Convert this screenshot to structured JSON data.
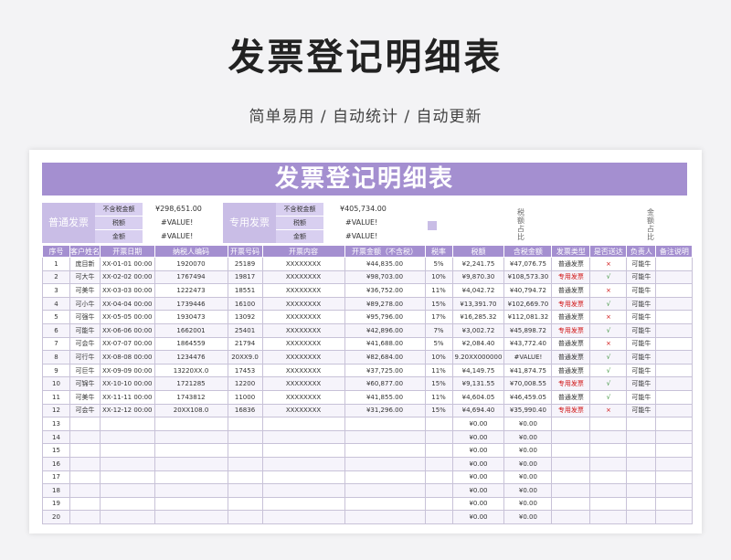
{
  "page": {
    "title": "发票登记明细表",
    "subtitle": "简单易用 / 自动统计 / 自动更新"
  },
  "sheet": {
    "banner": "发票登记明细表",
    "ordinary": {
      "label": "普通发票",
      "keys": [
        "不含税金额",
        "税额",
        "金额"
      ],
      "values": [
        "¥298,651.00",
        "#VALUE!",
        "#VALUE!"
      ]
    },
    "special": {
      "label": "专用发票",
      "keys": [
        "不含税金额",
        "税额",
        "金额"
      ],
      "values": [
        "¥405,734.00",
        "#VALUE!",
        "#VALUE!"
      ]
    },
    "side_notes": [
      "税额占比",
      "金额占比"
    ]
  },
  "table": {
    "headers": [
      "序号",
      "客户姓名",
      "开票日期",
      "纳税人编码",
      "开票号码",
      "开票内容",
      "开票金额（不含税）",
      "税率",
      "税额",
      "含税金额",
      "发票类型",
      "是否送达",
      "负责人",
      "备注说明"
    ],
    "rows": [
      [
        "1",
        "庞目新",
        "XX-01-01 00:00",
        "1920070",
        "25189",
        "XXXXXXXX",
        "¥44,835.00",
        "5%",
        "¥2,241.75",
        "¥47,076.75",
        "普通发票",
        "×",
        "可能牛",
        ""
      ],
      [
        "2",
        "可大牛",
        "XX-02-02 00:00",
        "1767494",
        "19817",
        "XXXXXXXX",
        "¥98,703.00",
        "10%",
        "¥9,870.30",
        "¥108,573.30",
        "专用发票",
        "√",
        "可能牛",
        ""
      ],
      [
        "3",
        "可美牛",
        "XX-03-03 00:00",
        "1222473",
        "18551",
        "XXXXXXXX",
        "¥36,752.00",
        "11%",
        "¥4,042.72",
        "¥40,794.72",
        "普通发票",
        "×",
        "可能牛",
        ""
      ],
      [
        "4",
        "可小牛",
        "XX-04-04 00:00",
        "1739446",
        "16100",
        "XXXXXXXX",
        "¥89,278.00",
        "15%",
        "¥13,391.70",
        "¥102,669.70",
        "专用发票",
        "√",
        "可能牛",
        ""
      ],
      [
        "5",
        "可强牛",
        "XX-05-05 00:00",
        "1930473",
        "13092",
        "XXXXXXXX",
        "¥95,796.00",
        "17%",
        "¥16,285.32",
        "¥112,081.32",
        "普通发票",
        "×",
        "可能牛",
        ""
      ],
      [
        "6",
        "可能牛",
        "XX-06-06 00:00",
        "1662001",
        "25401",
        "XXXXXXXX",
        "¥42,896.00",
        "7%",
        "¥3,002.72",
        "¥45,898.72",
        "专用发票",
        "√",
        "可能牛",
        ""
      ],
      [
        "7",
        "可会牛",
        "XX-07-07 00:00",
        "1864559",
        "21794",
        "XXXXXXXX",
        "¥41,688.00",
        "5%",
        "¥2,084.40",
        "¥43,772.40",
        "普通发票",
        "×",
        "可能牛",
        ""
      ],
      [
        "8",
        "可行牛",
        "XX-08-08 00:00",
        "1234476",
        "20XX9.0",
        "XXXXXXXX",
        "¥82,684.00",
        "10%",
        "9.20XX000000",
        "#VALUE!",
        "普通发票",
        "√",
        "可能牛",
        ""
      ],
      [
        "9",
        "可巨牛",
        "XX-09-09 00:00",
        "13220XX.0",
        "17453",
        "XXXXXXXX",
        "¥37,725.00",
        "11%",
        "¥4,149.75",
        "¥41,874.75",
        "普通发票",
        "√",
        "可能牛",
        ""
      ],
      [
        "10",
        "可锦牛",
        "XX-10-10 00:00",
        "1721285",
        "12200",
        "XXXXXXXX",
        "¥60,877.00",
        "15%",
        "¥9,131.55",
        "¥70,008.55",
        "专用发票",
        "√",
        "可能牛",
        ""
      ],
      [
        "11",
        "可美牛",
        "XX-11-11 00:00",
        "1743812",
        "11000",
        "XXXXXXXX",
        "¥41,855.00",
        "11%",
        "¥4,604.05",
        "¥46,459.05",
        "普通发票",
        "√",
        "可能牛",
        ""
      ],
      [
        "12",
        "可会牛",
        "XX-12-12 00:00",
        "20XX108.0",
        "16836",
        "XXXXXXXX",
        "¥31,296.00",
        "15%",
        "¥4,694.40",
        "¥35,990.40",
        "专用发票",
        "×",
        "可能牛",
        ""
      ],
      [
        "13",
        "",
        "",
        "",
        "",
        "",
        "",
        "",
        "¥0.00",
        "¥0.00",
        "",
        "",
        "",
        ""
      ],
      [
        "14",
        "",
        "",
        "",
        "",
        "",
        "",
        "",
        "¥0.00",
        "¥0.00",
        "",
        "",
        "",
        ""
      ],
      [
        "15",
        "",
        "",
        "",
        "",
        "",
        "",
        "",
        "¥0.00",
        "¥0.00",
        "",
        "",
        "",
        ""
      ],
      [
        "16",
        "",
        "",
        "",
        "",
        "",
        "",
        "",
        "¥0.00",
        "¥0.00",
        "",
        "",
        "",
        ""
      ],
      [
        "17",
        "",
        "",
        "",
        "",
        "",
        "",
        "",
        "¥0.00",
        "¥0.00",
        "",
        "",
        "",
        ""
      ],
      [
        "18",
        "",
        "",
        "",
        "",
        "",
        "",
        "",
        "¥0.00",
        "¥0.00",
        "",
        "",
        "",
        ""
      ],
      [
        "19",
        "",
        "",
        "",
        "",
        "",
        "",
        "",
        "¥0.00",
        "¥0.00",
        "",
        "",
        "",
        ""
      ],
      [
        "20",
        "",
        "",
        "",
        "",
        "",
        "",
        "",
        "¥0.00",
        "¥0.00",
        "",
        "",
        "",
        ""
      ]
    ]
  }
}
